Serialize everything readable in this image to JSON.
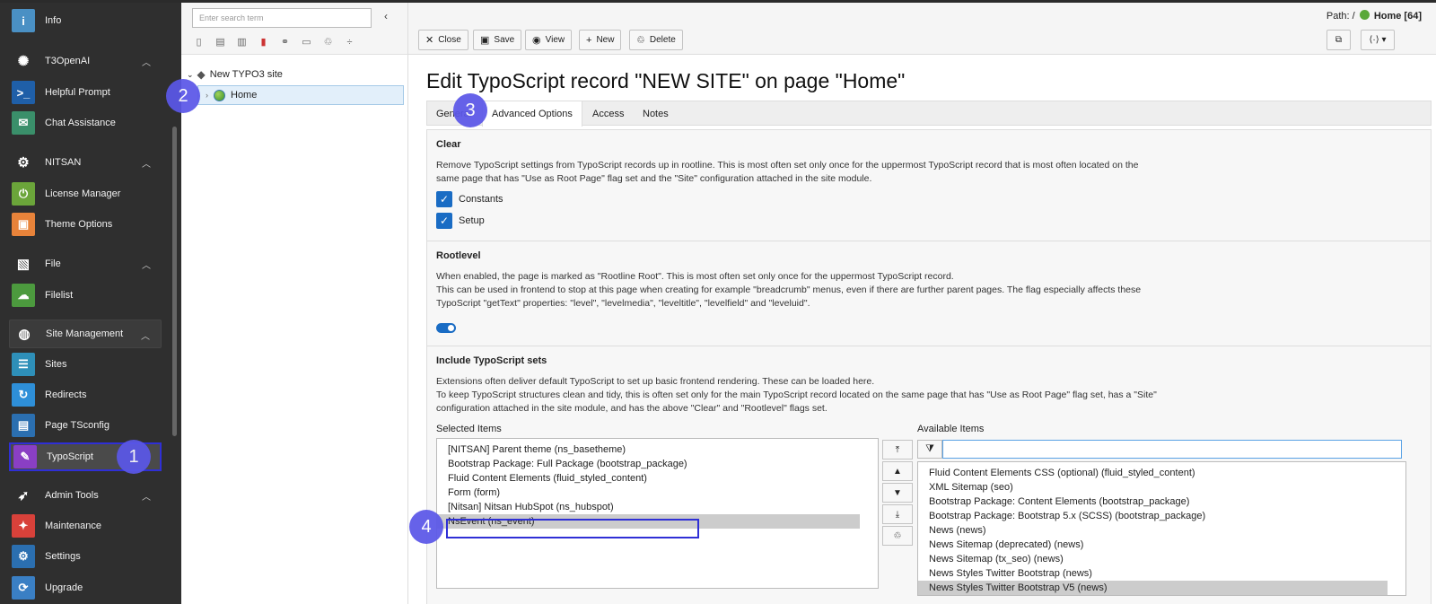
{
  "module_menu": {
    "items": [
      {
        "label": "Info",
        "icon": "info-icon",
        "color": "#4a90c4",
        "glyph": "i",
        "type": "module"
      },
      {
        "label": "T3OpenAI",
        "icon": "openai-icon",
        "color": "#2b9a6e",
        "glyph": "✺",
        "type": "group"
      },
      {
        "label": "Helpful Prompt",
        "icon": "terminal-icon",
        "color": "#1f5fa8",
        "glyph": ">_",
        "type": "module"
      },
      {
        "label": "Chat Assistance",
        "icon": "chat-icon",
        "color": "#3a8f6a",
        "glyph": "✉",
        "type": "module"
      },
      {
        "label": "NITSAN",
        "icon": "gear-icon",
        "color": "#555555",
        "glyph": "⚙",
        "type": "group"
      },
      {
        "label": "License Manager",
        "icon": "power-icon",
        "color": "#6ba53a",
        "glyph": "⏻",
        "type": "module"
      },
      {
        "label": "Theme Options",
        "icon": "box-icon",
        "color": "#e8833a",
        "glyph": "▣",
        "type": "module"
      },
      {
        "label": "File",
        "icon": "image-icon",
        "color": "#555555",
        "glyph": "▧",
        "type": "group"
      },
      {
        "label": "Filelist",
        "icon": "cloud-icon",
        "color": "#4c9a3e",
        "glyph": "☁",
        "type": "module"
      },
      {
        "label": "Site Management",
        "icon": "globe-icon",
        "color": "#555555",
        "glyph": "◍",
        "type": "group"
      },
      {
        "label": "Sites",
        "icon": "sites-icon",
        "color": "#2e8fb8",
        "glyph": "☰",
        "type": "module"
      },
      {
        "label": "Redirects",
        "icon": "redirect-icon",
        "color": "#2e8fd8",
        "glyph": "↻",
        "type": "module"
      },
      {
        "label": "Page TSconfig",
        "icon": "tsconfig-icon",
        "color": "#2b6fb0",
        "glyph": "▤",
        "type": "module"
      },
      {
        "label": "TypoScript",
        "icon": "typoscript-icon",
        "color": "#8a3fc4",
        "glyph": "✎",
        "type": "module"
      },
      {
        "label": "Admin Tools",
        "icon": "rocket-icon",
        "color": "#555555",
        "glyph": "➶",
        "type": "group"
      },
      {
        "label": "Maintenance",
        "icon": "wrench-icon",
        "color": "#d8413a",
        "glyph": "✦",
        "type": "module"
      },
      {
        "label": "Settings",
        "icon": "settings-icon",
        "color": "#2b6fb0",
        "glyph": "⚙",
        "type": "module"
      },
      {
        "label": "Upgrade",
        "icon": "upgrade-icon",
        "color": "#3a7fc4",
        "glyph": "⟳",
        "type": "module"
      }
    ]
  },
  "badges": [
    "1",
    "2",
    "3",
    "4"
  ],
  "page_tree": {
    "search_placeholder": "Enter search term",
    "root_label": "New TYPO3 site",
    "home_label": "Home"
  },
  "doc_header": {
    "path_prefix": "Path: /",
    "path_page": "Home [64]",
    "buttons": {
      "close": "Close",
      "save": "Save",
      "view": "View",
      "new": "New",
      "delete": "Delete"
    }
  },
  "form": {
    "title": "Edit TypoScript record \"NEW SITE\" on page \"Home\"",
    "tabs": [
      "General",
      "Advanced Options",
      "Access",
      "Notes"
    ],
    "active_tab": "Advanced Options",
    "clear": {
      "title": "Clear",
      "desc": "Remove TypoScript settings from TypoScript records up in rootline. This is most often set only once for the uppermost TypoScript record that is most often located on the same page that has \"Use as Root Page\" flag set and the \"Site\" configuration attached in the site module.",
      "constants": "Constants",
      "setup": "Setup"
    },
    "rootlevel": {
      "title": "Rootlevel",
      "desc1": "When enabled, the page is marked as \"Rootline Root\". This is most often set only once for the uppermost TypoScript record.",
      "desc2": "This can be used in frontend to stop at this page when creating for example \"breadcrumb\" menus, even if there are further parent pages. The flag especially affects these TypoScript \"getText\" properties: \"level\", \"levelmedia\", \"leveltitle\", \"levelfield\" and \"leveluid\"."
    },
    "include": {
      "title": "Include TypoScript sets",
      "desc1": "Extensions often deliver default TypoScript to set up basic frontend rendering. These can be loaded here.",
      "desc2": "To keep TypoScript structures clean and tidy, this is often set only for the main TypoScript record located on the same page that has \"Use as Root Page\" flag set, has a \"Site\" configuration attached in the site module, and has the above \"Clear\" and \"Rootlevel\" flags set.",
      "selected_label": "Selected Items",
      "available_label": "Available Items",
      "selected_items": [
        "[NITSAN] Parent theme (ns_basetheme)",
        "Bootstrap Package: Full Package (bootstrap_package)",
        "Fluid Content Elements (fluid_styled_content)",
        "Form (form)",
        "[Nitsan] Nitsan HubSpot (ns_hubspot)",
        "NsEvent (ns_event)"
      ],
      "available_items": [
        "Fluid Content Elements CSS (optional) (fluid_styled_content)",
        "XML Sitemap (seo)",
        "Bootstrap Package: Content Elements (bootstrap_package)",
        "Bootstrap Package: Bootstrap 5.x (SCSS) (bootstrap_package)",
        "News (news)",
        "News Sitemap (deprecated) (news)",
        "News Sitemap (tx_seo) (news)",
        "News Styles Twitter Bootstrap (news)",
        "News Styles Twitter Bootstrap V5 (news)"
      ]
    }
  }
}
